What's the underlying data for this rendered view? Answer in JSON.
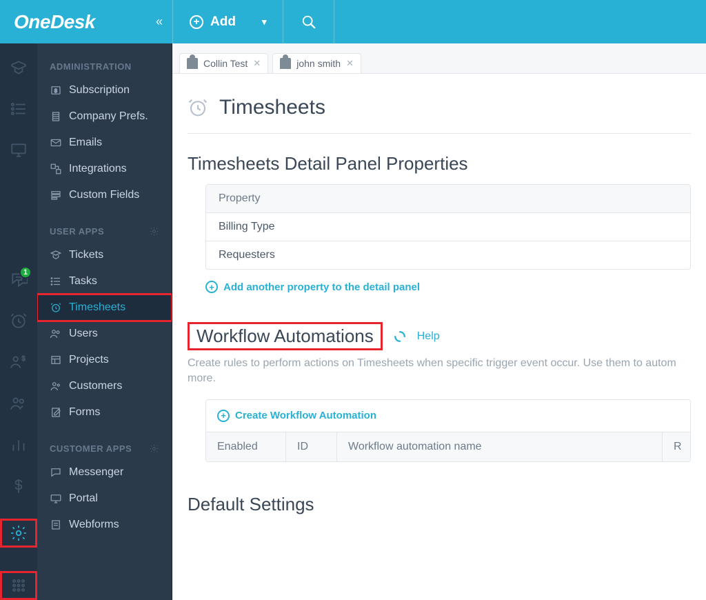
{
  "brand": "OneDesk",
  "topbar": {
    "add_label": "Add"
  },
  "rail": {
    "badge": "1"
  },
  "tabs": [
    {
      "label": "Collin Test"
    },
    {
      "label": "john smith"
    }
  ],
  "sidebar": {
    "section_admin": "ADMINISTRATION",
    "section_user": "USER APPS",
    "section_cust": "CUSTOMER APPS",
    "admin": [
      {
        "label": "Subscription"
      },
      {
        "label": "Company Prefs."
      },
      {
        "label": "Emails"
      },
      {
        "label": "Integrations"
      },
      {
        "label": "Custom Fields"
      }
    ],
    "user": [
      {
        "label": "Tickets"
      },
      {
        "label": "Tasks"
      },
      {
        "label": "Timesheets"
      },
      {
        "label": "Users"
      },
      {
        "label": "Projects"
      },
      {
        "label": "Customers"
      },
      {
        "label": "Forms"
      }
    ],
    "cust": [
      {
        "label": "Messenger"
      },
      {
        "label": "Portal"
      },
      {
        "label": "Webforms"
      }
    ]
  },
  "page": {
    "title": "Timesheets",
    "detail_heading": "Timesheets Detail Panel Properties",
    "property_header": "Property",
    "properties": [
      "Billing Type",
      "Requesters"
    ],
    "add_property": "Add another property to the detail panel",
    "workflow_heading": "Workflow Automations",
    "help_label": "Help",
    "workflow_desc": "Create rules to perform actions on Timesheets when specific trigger event occur. Use them to autom more.",
    "create_workflow": "Create Workflow Automation",
    "wf_cols": {
      "enabled": "Enabled",
      "id": "ID",
      "name": "Workflow automation name",
      "r": "R"
    },
    "default_heading": "Default Settings"
  }
}
